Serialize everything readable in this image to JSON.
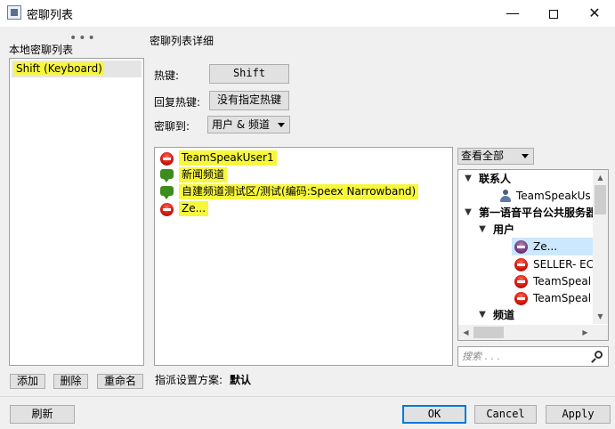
{
  "window": {
    "title": "密聊列表",
    "min_glyph": "—",
    "close_glyph": "✕"
  },
  "left": {
    "heading": "本地密聊列表",
    "grip": "•••",
    "items": [
      "Shift (Keyboard)"
    ],
    "add_label": "添加",
    "delete_label": "删除",
    "rename_label": "重命名"
  },
  "details": {
    "heading": "密聊列表详细",
    "hotkey_label": "热键:",
    "hotkey_value": "Shift",
    "reply_label": "回复热键:",
    "reply_value": "没有指定热键",
    "target_label": "密聊到:",
    "target_value": "用户 & 频道",
    "targets": [
      {
        "icon": "red",
        "text": "TeamSpeakUser1"
      },
      {
        "icon": "bubble",
        "text": "新闻频道"
      },
      {
        "icon": "bubble",
        "text": "自建频道测试区/测试(编码:Speex Narrowband)"
      },
      {
        "icon": "red",
        "text": "Ze..."
      }
    ],
    "view_filter": "查看全部",
    "tree": {
      "contacts_label": "联系人",
      "contact_item": "TeamSpeakUs",
      "server_label": "第一语音平台公共服务器",
      "users_label": "用户",
      "users": [
        "Ze...",
        "SELLER- EC",
        "TeamSpeal",
        "TeamSpeal"
      ],
      "channels_label": "频道"
    },
    "search_placeholder": "搜索 . . .",
    "scheme_label": "指派设置方案:",
    "scheme_value": "默认"
  },
  "footer": {
    "refresh_label": "刷新",
    "ok_label": "OK",
    "cancel_label": "Cancel",
    "apply_label": "Apply"
  },
  "colors": {
    "highlight": "#f7f73b",
    "selection": "#cce8ff"
  }
}
